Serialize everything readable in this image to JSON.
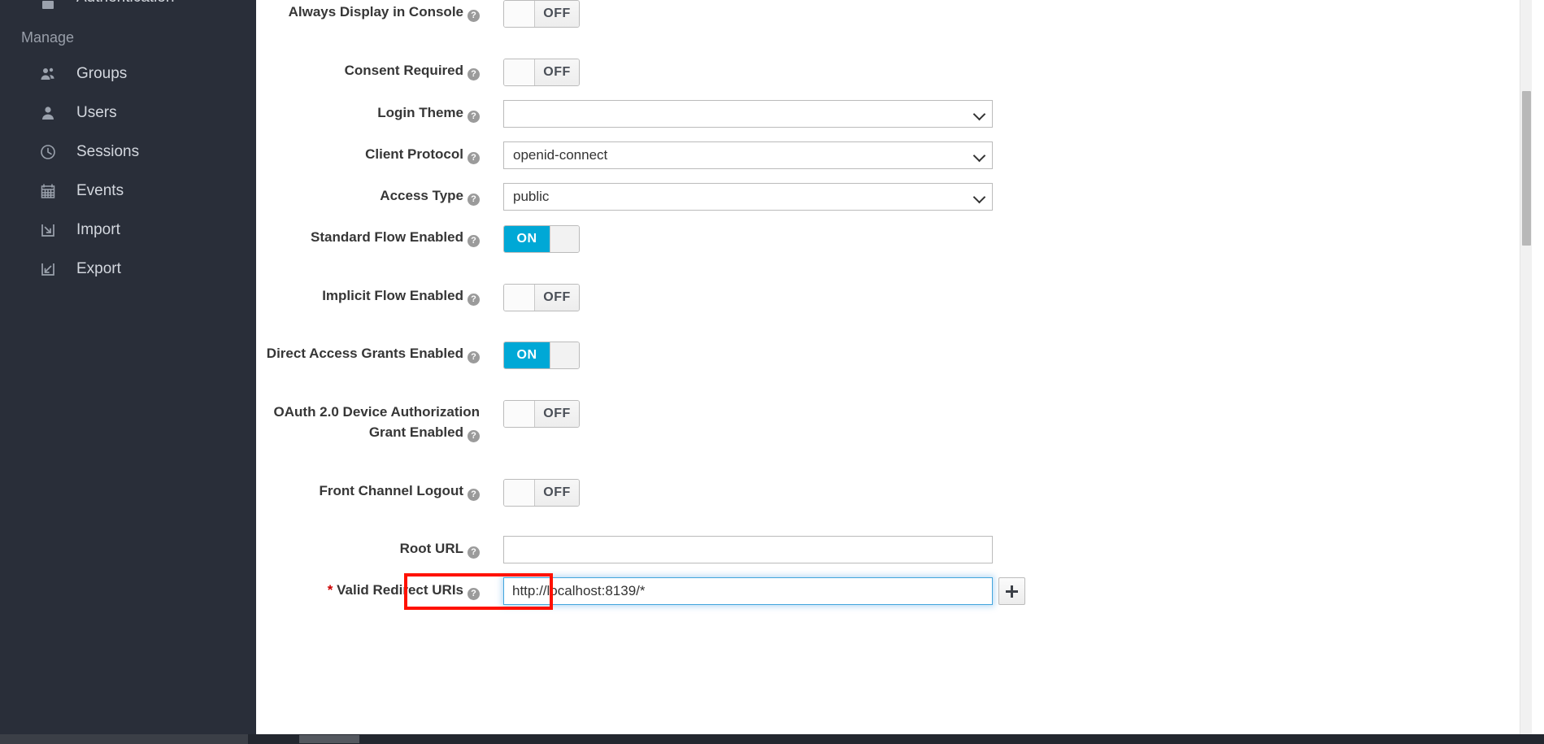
{
  "sidebar": {
    "clipped_item": {
      "label": "Authentication",
      "icon": "lock-icon"
    },
    "section_title": "Manage",
    "items": [
      {
        "label": "Groups",
        "icon": "groups-icon"
      },
      {
        "label": "Users",
        "icon": "user-icon"
      },
      {
        "label": "Sessions",
        "icon": "clock-icon"
      },
      {
        "label": "Events",
        "icon": "calendar-icon"
      },
      {
        "label": "Import",
        "icon": "import-arrow-icon"
      },
      {
        "label": "Export",
        "icon": "export-arrow-icon"
      }
    ]
  },
  "form": {
    "help_glyph": "?",
    "required_marker": "*",
    "rows": [
      {
        "label": "Always Display in Console",
        "type": "toggle",
        "value": "OFF"
      },
      {
        "label": "Consent Required",
        "type": "toggle",
        "value": "OFF"
      },
      {
        "label": "Login Theme",
        "type": "select",
        "value": ""
      },
      {
        "label": "Client Protocol",
        "type": "select",
        "value": "openid-connect"
      },
      {
        "label": "Access Type",
        "type": "select",
        "value": "public"
      },
      {
        "label": "Standard Flow Enabled",
        "type": "toggle",
        "value": "ON"
      },
      {
        "label": "Implicit Flow Enabled",
        "type": "toggle",
        "value": "OFF"
      },
      {
        "label": "Direct Access Grants Enabled",
        "type": "toggle",
        "value": "ON"
      },
      {
        "label": "OAuth 2.0 Device Authorization Grant Enabled",
        "type": "toggle",
        "value": "OFF"
      },
      {
        "label": "Front Channel Logout",
        "type": "toggle",
        "value": "OFF"
      },
      {
        "label": "Root URL",
        "type": "text",
        "value": ""
      },
      {
        "label": "Valid Redirect URIs",
        "type": "text-add",
        "value": "http://localhost:8139/*",
        "required": true
      }
    ]
  },
  "colors": {
    "sidebar_bg": "#292e39",
    "toggle_on": "#00a8d6",
    "focus_border": "#42a5dd",
    "annotation": "#ff1100",
    "required": "#cc0000"
  },
  "labels": {
    "off": "OFF",
    "on": "ON",
    "add_button": "+"
  }
}
